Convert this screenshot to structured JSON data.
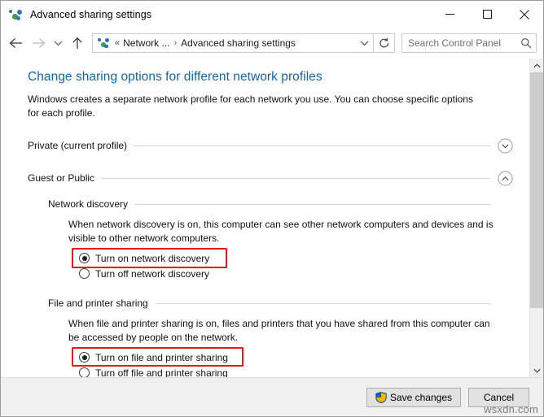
{
  "window": {
    "title": "Advanced sharing settings",
    "icon": "network-sharing-icon",
    "minimize_label": "Minimize",
    "maximize_label": "Maximize",
    "close_label": "Close"
  },
  "toolbar": {
    "back_label": "Back",
    "forward_label": "Forward",
    "recent_label": "Recent locations",
    "up_label": "Up",
    "breadcrumb": {
      "icon": "network-sharing-icon",
      "overflow": "«",
      "items": [
        "Network ...",
        "Advanced sharing settings"
      ],
      "separator": "›"
    },
    "dropdown_label": "Previous locations",
    "refresh_label": "Refresh",
    "search": {
      "placeholder": "Search Control Panel",
      "value": "",
      "icon": "search-icon"
    }
  },
  "main": {
    "page_title": "Change sharing options for different network profiles",
    "intro": "Windows creates a separate network profile for each network you use. You can choose specific options for each profile.",
    "profiles": [
      {
        "label": "Private (current profile)",
        "expanded": false,
        "chevron": "chevron-down-icon"
      },
      {
        "label": "Guest or Public",
        "expanded": true,
        "chevron": "chevron-up-icon"
      }
    ],
    "sections": [
      {
        "heading": "Network discovery",
        "description": "When network discovery is on, this computer can see other network computers and devices and is visible to other network computers.",
        "options": [
          {
            "label": "Turn on network discovery",
            "selected": true,
            "highlighted": true
          },
          {
            "label": "Turn off network discovery",
            "selected": false,
            "highlighted": false
          }
        ]
      },
      {
        "heading": "File and printer sharing",
        "description": "When file and printer sharing is on, files and printers that you have shared from this computer can be accessed by people on the network.",
        "options": [
          {
            "label": "Turn on file and printer sharing",
            "selected": true,
            "highlighted": true
          },
          {
            "label": "Turn off file and printer sharing",
            "selected": false,
            "highlighted": false
          }
        ]
      }
    ]
  },
  "scrollbar": {
    "up_label": "Scroll up",
    "down_label": "Scroll down",
    "thumb_label": "Scroll thumb"
  },
  "footer": {
    "save_label": "Save changes",
    "save_icon": "uac-shield-icon",
    "cancel_label": "Cancel"
  },
  "watermark": "wsxdn.com",
  "colors": {
    "title_link": "#1764a8",
    "highlight": "#e01b22",
    "chrome": "#f0f0f0"
  }
}
